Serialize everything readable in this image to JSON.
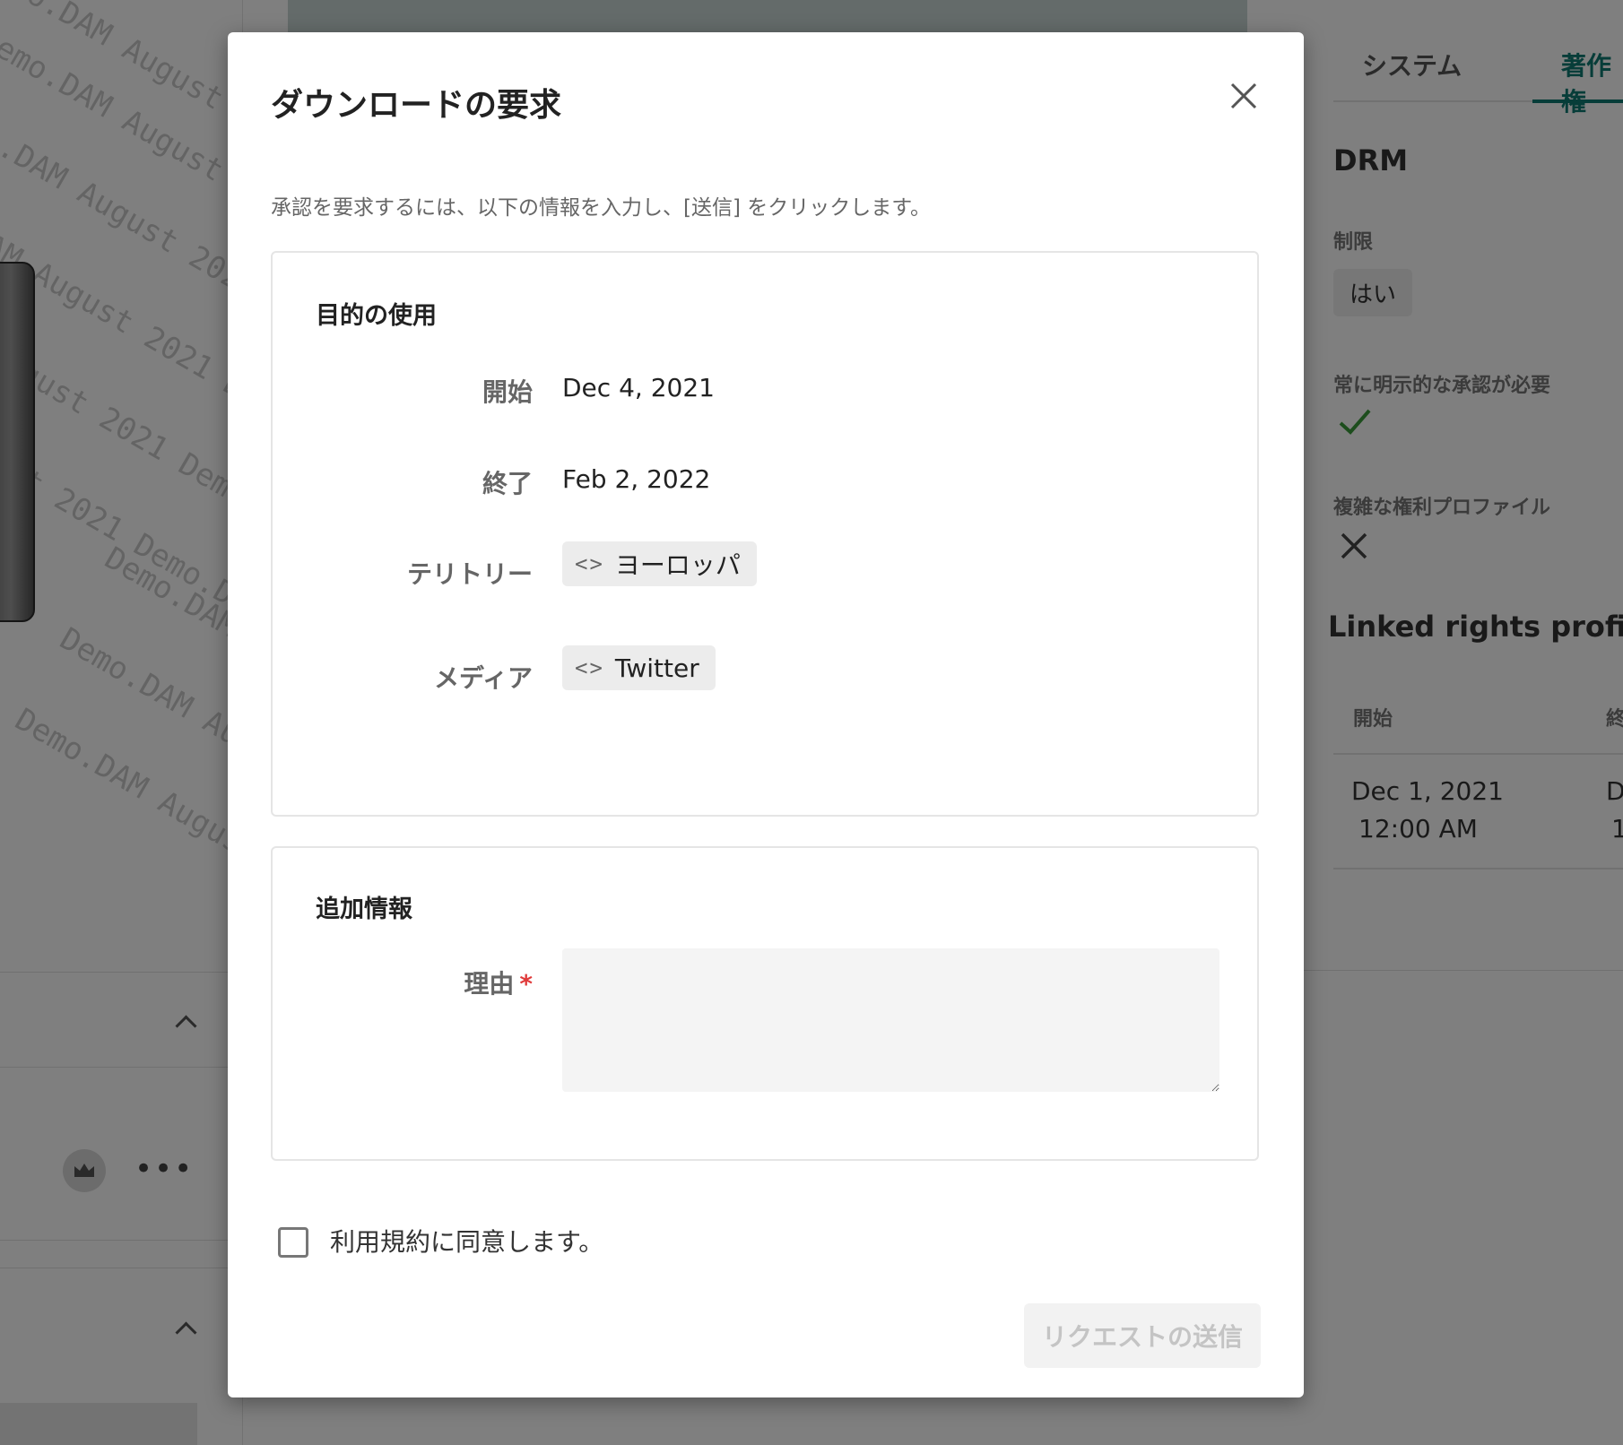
{
  "background": {
    "watermark_text": [
      "Demo.DAM August 2021 Demo.DAM",
      "Demo.DAM August 2021 Demo.DAM",
      "Demo.DAM August 2021 Demo.DAM",
      "Demo.DAM August 2021 Demo.DAM",
      "Demo.DAM August 2021 Demo.DAM",
      "Demo.DAM August 2021 Demo.DAM",
      "Demo.DAM August 2021 Demo.DAM",
      "Demo.DAM August 2021 Demo.DAM",
      "Demo.DAM August 2021 Demo.DAM"
    ],
    "more_menu": "•••"
  },
  "right_panel": {
    "tabs": [
      "システム",
      "著作権"
    ],
    "active_tab": "著作権",
    "drm_heading": "DRM",
    "restriction_label": "制限",
    "restriction_value": "はい",
    "explicit_approval_label": "常に明示的な承認が必要",
    "complex_profile_label": "複雑な権利プロファイル",
    "linked_heading": "Linked rights profiles",
    "table_headers": [
      "開始",
      "終"
    ],
    "table_row": {
      "start_date": "Dec 1, 2021",
      "start_time": "12:00 AM",
      "end_date": "D",
      "end_time": "1"
    }
  },
  "modal": {
    "title": "ダウンロードの要求",
    "description": "承認を要求するには、以下の情報を入力し、[送信] をクリックします。",
    "usage_section": {
      "title": "目的の使用",
      "start_label": "開始",
      "start_value": "Dec 4, 2021",
      "end_label": "終了",
      "end_value": "Feb 2, 2022",
      "territory_label": "テリトリー",
      "territory_value": "ヨーロッパ",
      "media_label": "メディア",
      "media_value": "Twitter",
      "chip_icon": "<>"
    },
    "extra_section": {
      "title": "追加情報",
      "reason_label": "理由",
      "required_mark": "*",
      "reason_value": ""
    },
    "terms_label": "利用規約に同意します。",
    "submit_label": "リクエストの送信"
  },
  "colors": {
    "accent": "#0f7a72",
    "required": "#e03a3a",
    "check": "#3a9a3a",
    "overlay": "rgba(0,0,0,0.5)"
  },
  "icons": {
    "close": "close-icon",
    "chip": "code-brackets-icon",
    "check": "checkmark-icon",
    "cross": "x-icon",
    "crown": "crown-icon",
    "chevron": "chevron-up-icon"
  }
}
